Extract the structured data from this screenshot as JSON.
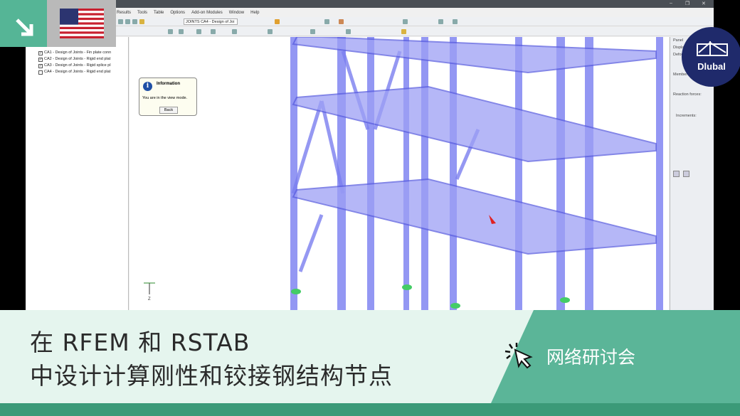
{
  "app": {
    "window_controls": [
      "–",
      "❐",
      "✕"
    ],
    "menu": [
      "Results",
      "Tools",
      "Table",
      "Options",
      "Add-on Modules",
      "Window",
      "Help"
    ],
    "case_combo": "JOINTS CA4 - Design of Joi",
    "tree": [
      {
        "label": "CA1 - Design of Joints - Fin plate conn",
        "checked": true
      },
      {
        "label": "CA2 - Design of Joints - Rigid end plat",
        "checked": true
      },
      {
        "label": "CA3 - Design of Joints - Rigid splice pl",
        "checked": true
      },
      {
        "label": "CA4 - Design of Joints - Rigid end plat",
        "checked": false
      }
    ],
    "dialog": {
      "title": "Information",
      "message": "You are in the view mode.",
      "button": "Back"
    },
    "panel": {
      "title": "Panel",
      "display": "Display",
      "deformation": "Deform",
      "member": "Member d",
      "reaction": "Reaction forces:",
      "increments": "Increments:"
    },
    "axis_label": "Z"
  },
  "overlay": {
    "logo": "Dlubal",
    "title_line1": "在 RFEM 和 RSTAB",
    "title_line2": "中设计计算刚性和铰接钢结构节点",
    "tag": "网络研讨会"
  },
  "colors": {
    "teal": "#55b596",
    "banner": "#e5f5ee",
    "accent": "#5bb598",
    "dlubal": "#1f2a6b",
    "steel": "#7b7ff0"
  }
}
